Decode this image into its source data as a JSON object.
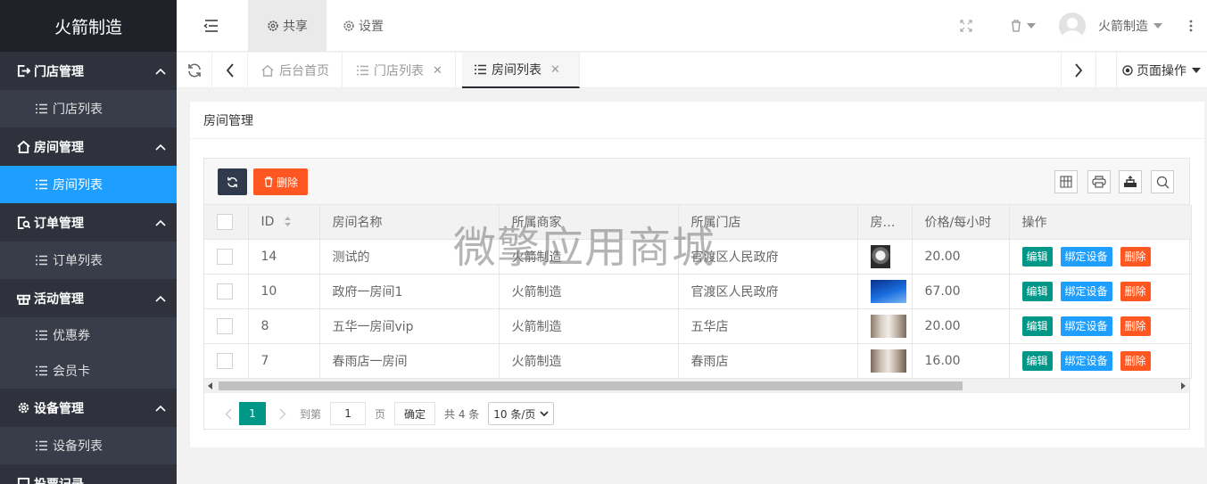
{
  "brand": "火箭制造",
  "sidebar": {
    "groups": [
      {
        "label": "门店管理",
        "items": [
          "门店列表"
        ]
      },
      {
        "label": "房间管理",
        "items": [
          "房间列表"
        ]
      },
      {
        "label": "订单管理",
        "items": [
          "订单列表"
        ]
      },
      {
        "label": "活动管理",
        "items": [
          "优惠券",
          "会员卡"
        ]
      },
      {
        "label": "设备管理",
        "items": [
          "设备列表"
        ]
      },
      {
        "label": "投票记录"
      }
    ],
    "active_item": "房间列表"
  },
  "header": {
    "share": "共享",
    "settings": "设置",
    "user": "火箭制造"
  },
  "tabs": {
    "home": "后台首页",
    "store_list": "门店列表",
    "room_list": "房间列表",
    "page_ops": "页面操作"
  },
  "card": {
    "title": "房间管理",
    "delete_label": "删除"
  },
  "table": {
    "headers": {
      "id": "ID",
      "name": "房间名称",
      "merchant": "所属商家",
      "store": "所属门店",
      "image": "房…",
      "price": "价格/每小时",
      "ops": "操作"
    },
    "rows": [
      {
        "id": "14",
        "name": "测试的",
        "merchant": "火箭制造",
        "store": "官渡区人民政府",
        "price": "20.00",
        "thumb": "dog"
      },
      {
        "id": "10",
        "name": "政府一房间1",
        "merchant": "火箭制造",
        "store": "官渡区人民政府",
        "price": "67.00",
        "thumb": "sky"
      },
      {
        "id": "8",
        "name": "五华一房间vip",
        "merchant": "火箭制造",
        "store": "五华店",
        "price": "20.00",
        "thumb": "room"
      },
      {
        "id": "7",
        "name": "春雨店一房间",
        "merchant": "火箭制造",
        "store": "春雨店",
        "price": "16.00",
        "thumb": "room"
      }
    ],
    "op_edit": "编辑",
    "op_bind": "绑定设备",
    "op_delete": "删除"
  },
  "pager": {
    "current": "1",
    "goto_label": "到第",
    "goto_value": "1",
    "page_unit": "页",
    "confirm": "确定",
    "total": "共 4 条",
    "per_page": "10 条/页"
  },
  "watermark": "微擎应用商城",
  "colors": {
    "sidebar": "#393d49",
    "active": "#1e9fff",
    "primary": "#009688",
    "danger": "#ff5722"
  }
}
